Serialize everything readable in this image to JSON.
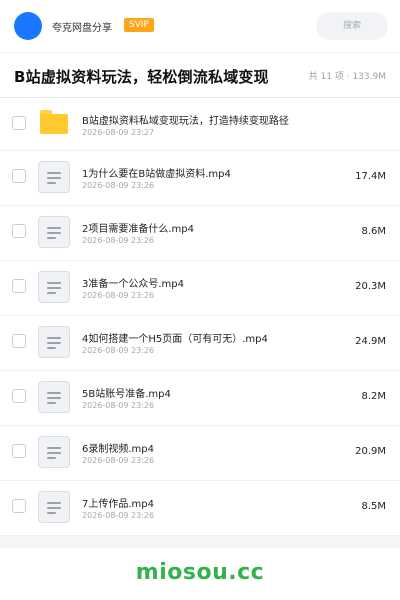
{
  "header": {
    "brand": "夸克网盘分享",
    "badge": "SVIP",
    "search_placeholder": "搜索"
  },
  "title_bar": {
    "title": "B站虚拟资料玩法，轻松倒流私域变现",
    "meta": "共 11 项 · 133.9M"
  },
  "files": [
    {
      "type": "folder",
      "icon": "folder-icon",
      "name": "B站虚拟资料私域变现玩法，打造持续变现路径",
      "date": "2026-08-09 23:27",
      "size": ""
    },
    {
      "type": "file",
      "icon": "file-icon",
      "name": "1为什么要在B站做虚拟资料.mp4",
      "date": "2026-08-09 23:26",
      "size": "17.4M"
    },
    {
      "type": "file",
      "icon": "file-icon",
      "name": "2项目需要准备什么.mp4",
      "date": "2026-08-09 23:26",
      "size": "8.6M"
    },
    {
      "type": "file",
      "icon": "file-icon",
      "name": "3准备一个公众号.mp4",
      "date": "2026-08-09 23:26",
      "size": "20.3M"
    },
    {
      "type": "file",
      "icon": "file-icon",
      "name": "4如何搭建一个H5页面（可有可无）.mp4",
      "date": "2026-08-09 23:26",
      "size": "24.9M"
    },
    {
      "type": "file",
      "icon": "file-icon",
      "name": "5B站账号准备.mp4",
      "date": "2026-08-09 23:26",
      "size": "8.2M"
    },
    {
      "type": "file",
      "icon": "file-icon",
      "name": "6录制视频.mp4",
      "date": "2026-08-09 23:26",
      "size": "20.9M"
    },
    {
      "type": "file",
      "icon": "file-icon",
      "name": "7上传作品.mp4",
      "date": "2026-08-09 23:26",
      "size": "8.5M"
    }
  ],
  "footer": {
    "logo": "miosou.cc"
  },
  "colors": {
    "accent": "#1a78ff",
    "badge": "#ffa51a",
    "folder": "#ffc82d",
    "footer_logo": "#34b24c"
  }
}
